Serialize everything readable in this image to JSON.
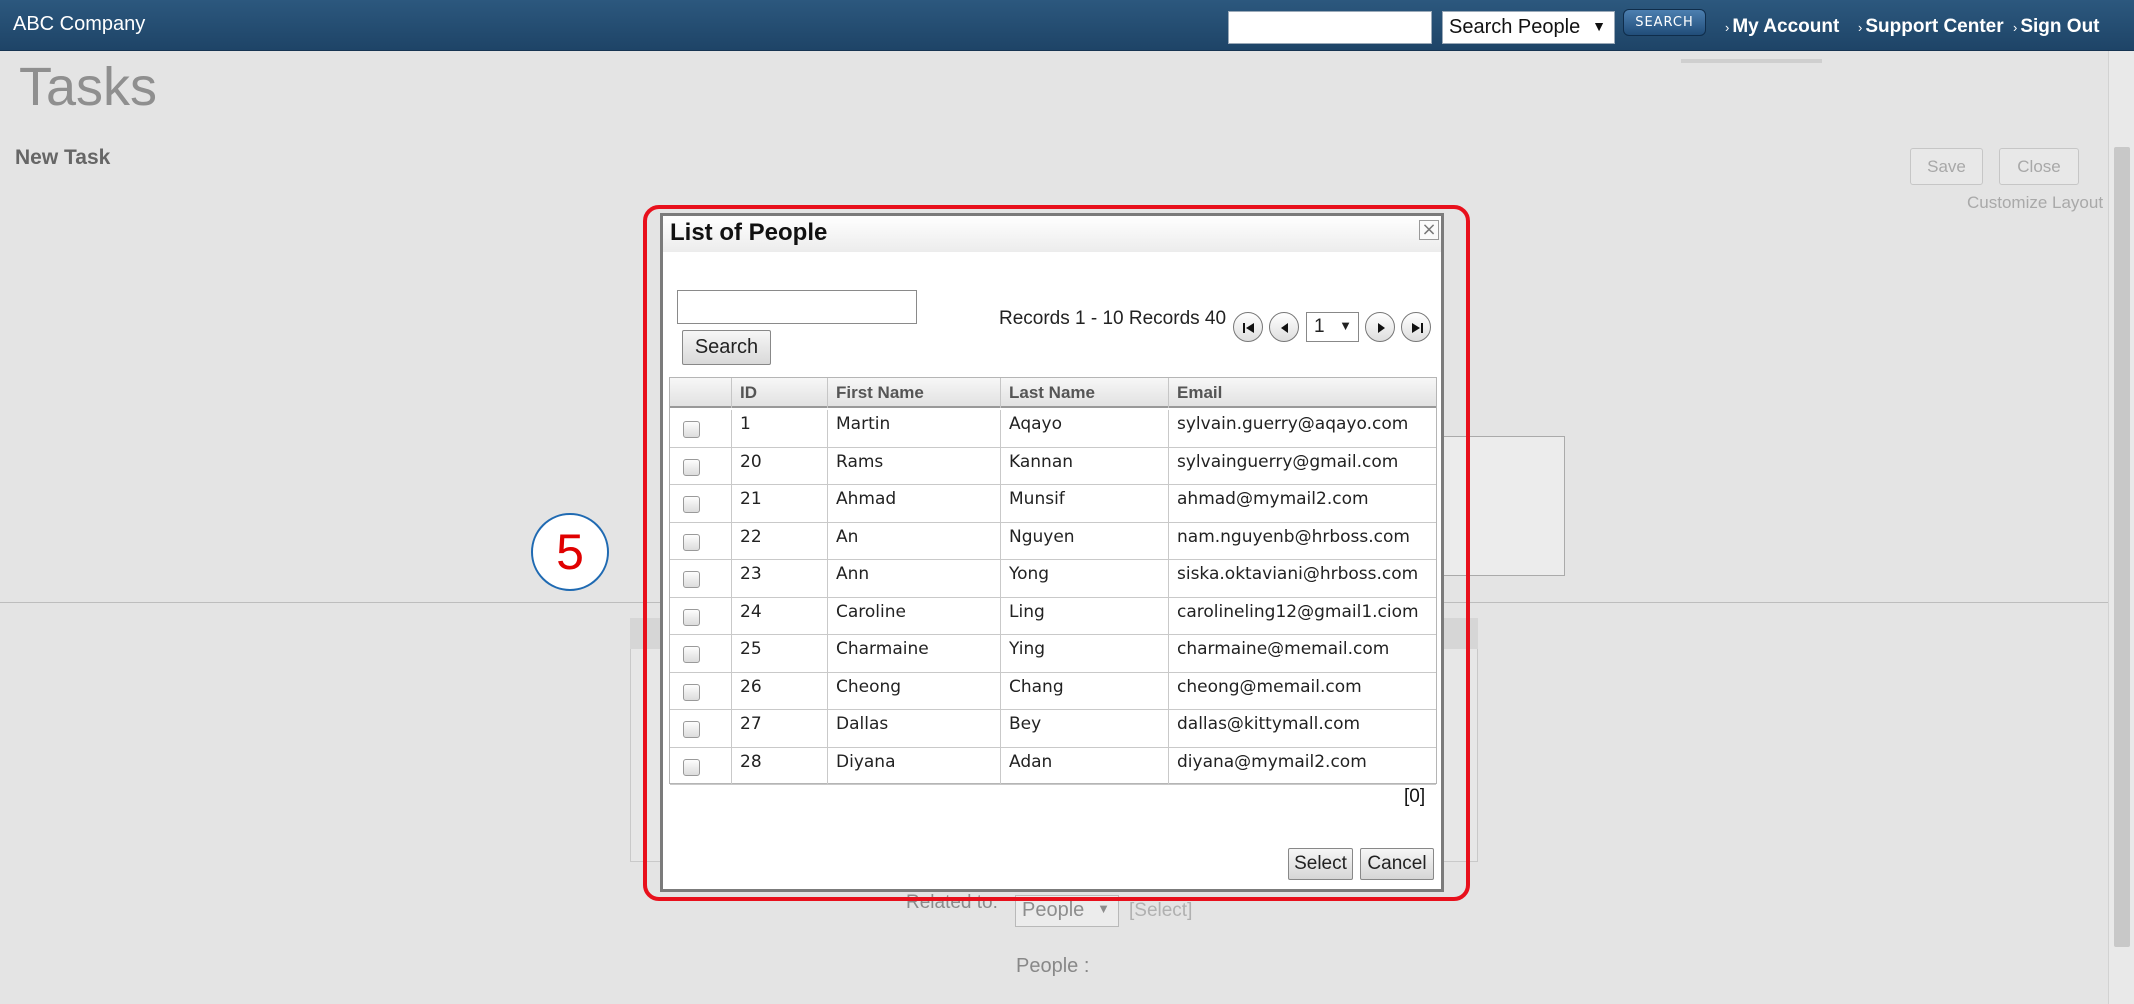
{
  "app": {
    "company": "ABC Company",
    "search_scope": "Search People",
    "search_button": "SEARCH",
    "links": [
      "My Account",
      "Support Center",
      "Sign Out"
    ]
  },
  "page": {
    "title": "Tasks",
    "subtitle": "New Task",
    "save_label": "Save",
    "close_label": "Close",
    "customize_label": "Customize Layout",
    "related_label": "Related to:",
    "related_value": "People",
    "related_select_link": "[Select]",
    "people_label": "People :"
  },
  "step_marker": "5",
  "dialog": {
    "title": "List of People",
    "close_glyph": "×",
    "search_button": "Search",
    "records_text": "Records 1 - 10 Records 40",
    "current_page": "1",
    "columns": [
      "ID",
      "First Name",
      "Last Name",
      "Email"
    ],
    "rows": [
      {
        "id": "1",
        "first": "Martin",
        "last": "Aqayo",
        "email": "sylvain.guerry@aqayo.com"
      },
      {
        "id": "20",
        "first": "Rams",
        "last": "Kannan",
        "email": "sylvainguerry@gmail.com"
      },
      {
        "id": "21",
        "first": "Ahmad",
        "last": "Munsif",
        "email": "ahmad@mymail2.com"
      },
      {
        "id": "22",
        "first": "An",
        "last": "Nguyen",
        "email": "nam.nguyenb@hrboss.com"
      },
      {
        "id": "23",
        "first": "Ann",
        "last": "Yong",
        "email": "siska.oktaviani@hrboss.com"
      },
      {
        "id": "24",
        "first": "Caroline",
        "last": "Ling",
        "email": "carolineling12@gmail1.ciom"
      },
      {
        "id": "25",
        "first": "Charmaine",
        "last": "Ying",
        "email": "charmaine@memail.com"
      },
      {
        "id": "26",
        "first": "Cheong",
        "last": "Chang",
        "email": "cheong@memail.com"
      },
      {
        "id": "27",
        "first": "Dallas",
        "last": "Bey",
        "email": "dallas@kittymall.com"
      },
      {
        "id": "28",
        "first": "Diyana",
        "last": "Adan",
        "email": "diyana@mymail2.com"
      }
    ],
    "selected_count": "[0]",
    "select_button": "Select",
    "cancel_button": "Cancel"
  },
  "colors": {
    "topbar": "#1e4467",
    "highlight": "#e8101c",
    "step_text": "#e00000"
  }
}
